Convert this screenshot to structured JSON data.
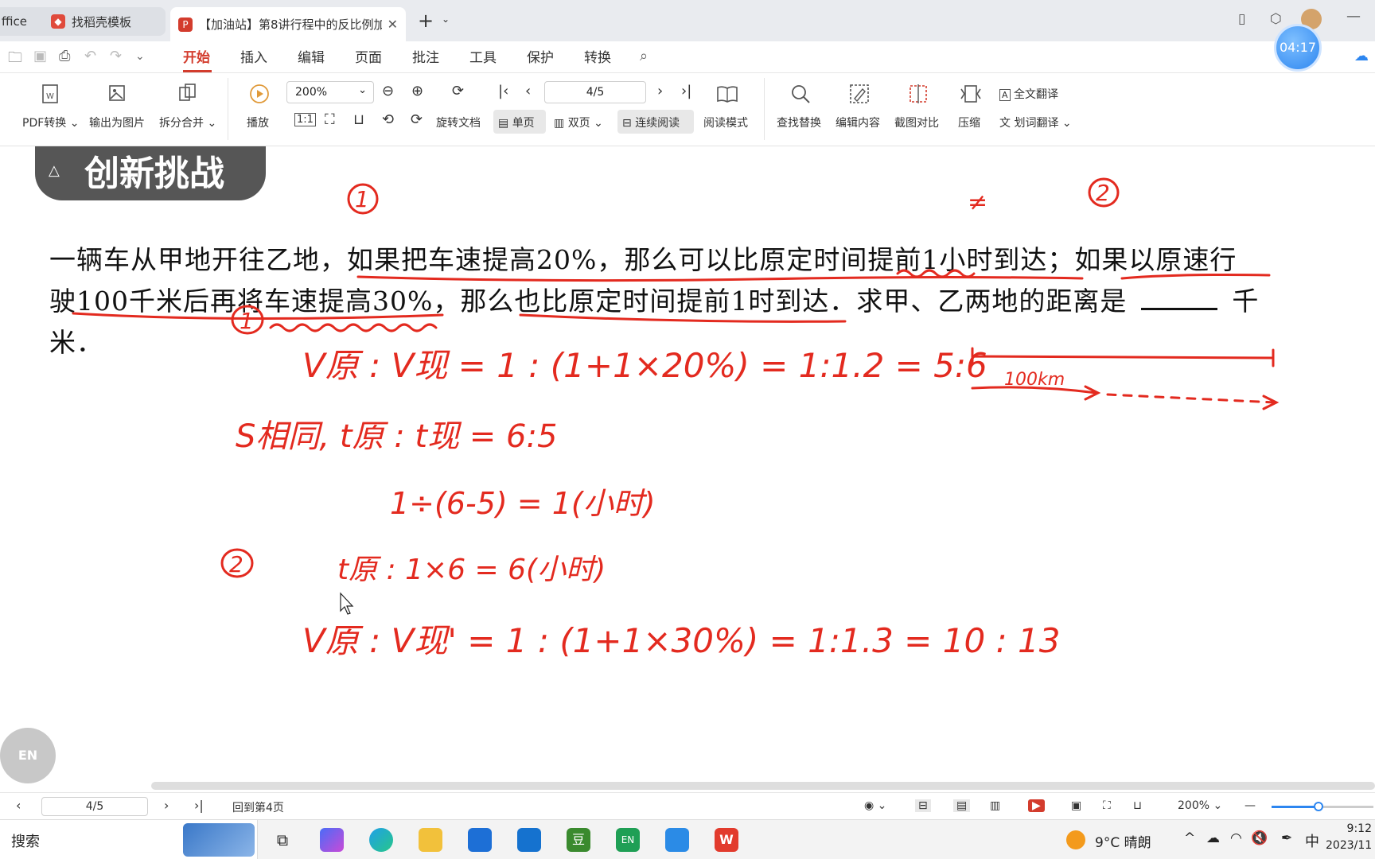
{
  "tabs": [
    {
      "label": "ffice"
    },
    {
      "label": "找稻壳模板"
    },
    {
      "label": "【加油站】第8讲行程中的反比例加"
    }
  ],
  "timer": "04:17",
  "menu": [
    "开始",
    "插入",
    "编辑",
    "页面",
    "批注",
    "工具",
    "保护",
    "转换"
  ],
  "ribbon": {
    "pdf_convert": "PDF转换 ⌄",
    "export_image": "输出为图片",
    "split_merge": "拆分合并 ⌄",
    "play": "播放",
    "zoom": "200%",
    "rotate": "旋转文档",
    "page": "4/5",
    "single_page": "单页",
    "double_page": "双页",
    "continuous": "连续阅读",
    "read_mode": "阅读模式",
    "find_replace": "查找替换",
    "edit_content": "编辑内容",
    "screenshot_compare": "截图对比",
    "compress": "压缩",
    "full_translate": "全文翻译",
    "word_translate": "划词翻译"
  },
  "document": {
    "banner": "创新挑战",
    "problem_lines": [
      "一辆车从甲地开往乙地，如果把车速提高20%，那么可以比原定时间提前1小时到达；如果以原速行",
      "驶100千米后再将车速提高30%，那么也比原定时间提前1时到达．求甲、乙两地的距离是",
      "千",
      "米．"
    ]
  },
  "annotations": {
    "label1": "1",
    "label2": "2",
    "star_mark": "≠",
    "line1": "V原 : V现 = 1 : (1+1×20%) = 1:1.2 = 5:6",
    "line2": "S相同, t原 : t现 = 6:5",
    "line3": "1÷(6-5) = 1(小时)",
    "line4": "t原 : 1×6 = 6(小时)",
    "line5": "V原 : V现' = 1 : (1+1×30%) = 1:1.3 = 10 : 13",
    "distance_label": "100km"
  },
  "float_en": "EN",
  "status": {
    "page": "4/5",
    "back_to_page": "回到第4页",
    "zoom": "200%",
    "zoom_level": 0.46
  },
  "taskbar": {
    "search": "搜索",
    "weather": "9°C 晴朗",
    "ime": "中",
    "time": "9:12",
    "date": "2023/11"
  }
}
